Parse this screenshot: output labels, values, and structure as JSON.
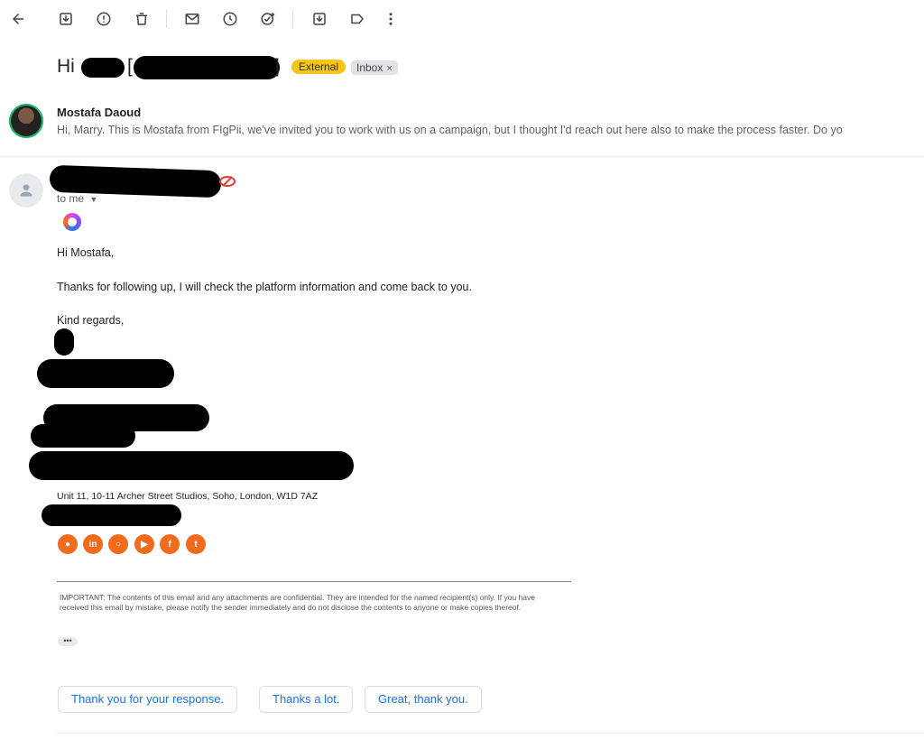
{
  "toolbar": {
    "icons": [
      "back-arrow-icon",
      "archive-icon",
      "report-spam-icon",
      "delete-icon",
      "mark-unread-icon",
      "snooze-icon",
      "add-task-icon",
      "move-to-icon",
      "label-icon",
      "more-vert-icon"
    ]
  },
  "subject": {
    "visible_text": "Hi",
    "bracket_open": "[",
    "bracket_close": "]",
    "tags": {
      "external": "External",
      "inbox": "Inbox",
      "inbox_remove": "×"
    }
  },
  "first_message": {
    "sender_name": "Mostafa Daoud",
    "snippet": "Hi, Marry. This is Mostafa from FIgPii, we've invited you to work with us on a campaign, but I thought I'd reach out here also to make the process faster. Do yo"
  },
  "second_message": {
    "to_label": "to me",
    "greeting": "Hi Mostafa,",
    "line1": "Thanks for following up, I will check the platform information and come back to you.",
    "closing": "Kind regards,",
    "address": "Unit 11, 10-11 Archer Street Studios, Soho, London, W1D 7AZ",
    "social_icons": [
      "rss-icon",
      "linkedin-icon",
      "instagram-icon",
      "youtube-icon",
      "facebook-icon",
      "twitter-icon"
    ],
    "social_glyphs": [
      "●",
      "in",
      "○",
      "▶",
      "f",
      "t"
    ],
    "disclaimer": "IMPORTANT: The contents of this email and any attachments are confidential. They are intended for the named recipient(s) only. If you have received this email by mistake, please notify the sender immediately and do not disclose the contents to anyone or make copies thereof.",
    "show_trimmed": "•••"
  },
  "smart_replies": [
    "Thank you for your response.",
    "Thanks a lot.",
    "Great, thank you."
  ],
  "colors": {
    "external_tag": "#f5c518",
    "social": "#f26b1d",
    "reply_text": "#1a73e8"
  }
}
